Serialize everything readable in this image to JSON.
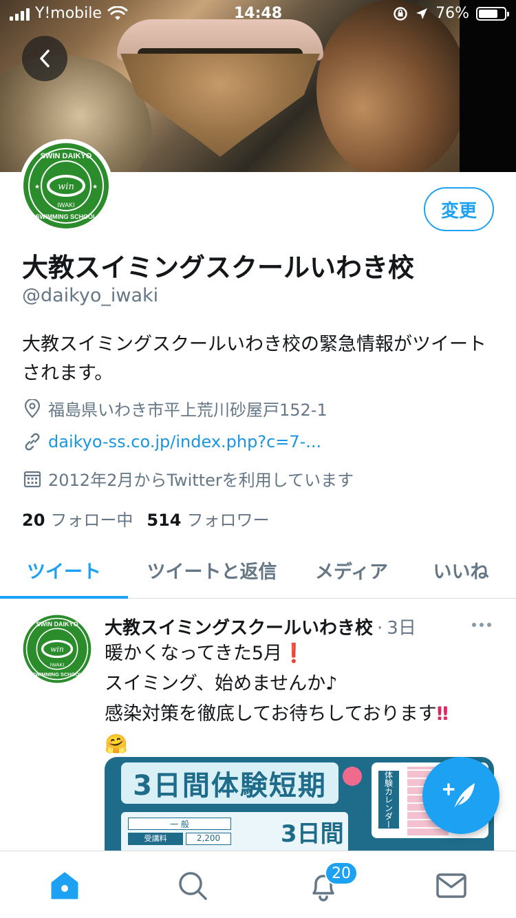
{
  "status_bar": {
    "carrier": "Y!mobile",
    "time": "14:48",
    "battery": "76%",
    "battery_level": 0.76
  },
  "profile": {
    "name": "大教スイミングスクールいわき校",
    "handle": "@daikyo_iwaki",
    "bio": "大教スイミングスクールいわき校の緊急情報がツイートされます。",
    "location": "福島県いわき市平上荒川砂屋戸152-1",
    "website": "daikyo-ss.co.jp/index.php?c=7-...",
    "joined": "2012年2月からTwitterを利用しています",
    "following_count": "20",
    "following_label": "フォロー中",
    "followers_count": "514",
    "followers_label": "フォロワー",
    "edit_button": "変更",
    "logo_text_top": "SWIN DAIKYO",
    "logo_text_bottom": "SWIMMING SCHOOL",
    "logo_text_mid": "IWAKI"
  },
  "tabs": [
    {
      "label": "ツイート",
      "active": true
    },
    {
      "label": "ツイートと返信",
      "active": false
    },
    {
      "label": "メディア",
      "active": false
    },
    {
      "label": "いいね",
      "active": false
    }
  ],
  "tweet": {
    "author": "大教スイミングスクールいわき校",
    "separator": "·",
    "age": "3日",
    "line1": "暖かくなってきた5月",
    "line1_emoji": "❗",
    "line2": "スイミング、始めませんか♪",
    "line3": "感染対策を徹底してお待ちしております",
    "line3_emoji": "‼",
    "line4_emoji": "🤗",
    "media": {
      "title": "3日間体験短期",
      "calendar_label": "体験カレンダー",
      "days_text": "3日間",
      "fee_label": "受講料",
      "fee_value": "2,200",
      "category": "一 般"
    }
  },
  "bottom_nav": {
    "notification_badge": "20"
  },
  "colors": {
    "accent": "#1da1f2",
    "text_primary": "#14171a",
    "text_secondary": "#657786",
    "link": "#1b95e0",
    "logo_green": "#2b8c2b",
    "emoji_red": "#e0245e"
  }
}
